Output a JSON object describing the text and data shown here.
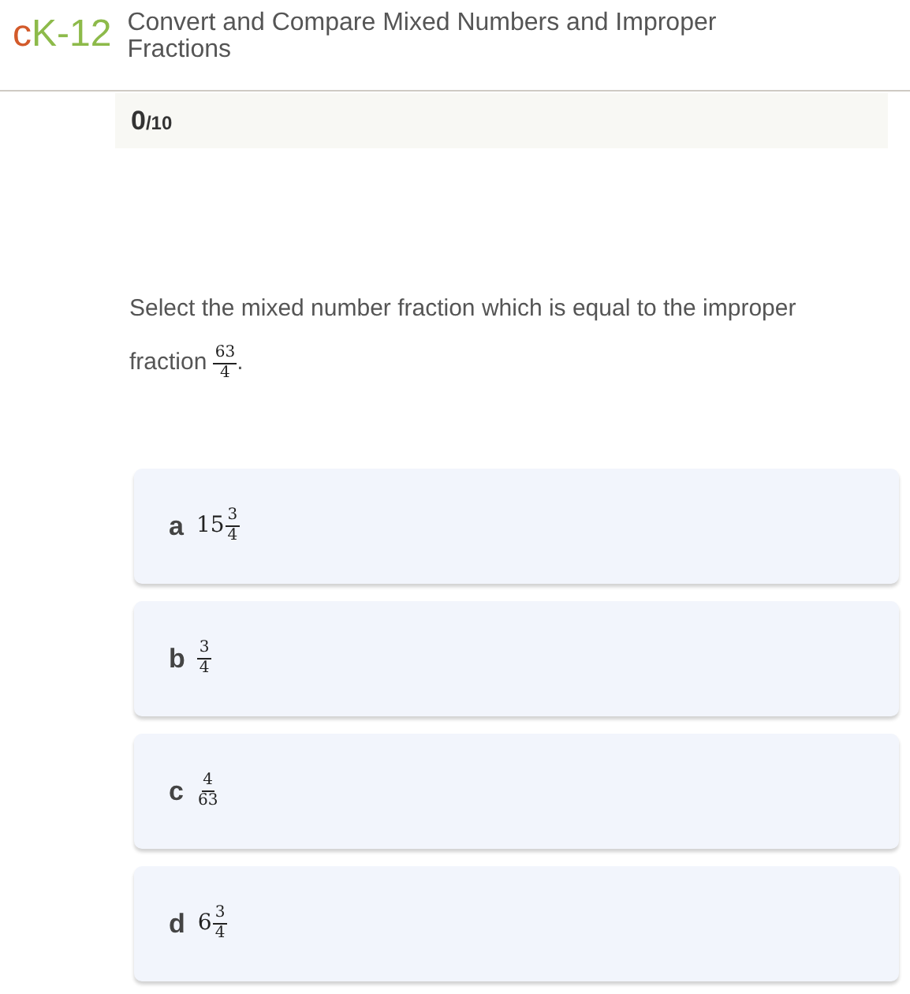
{
  "header": {
    "logo": [
      {
        "text": "c",
        "color": "#d35a2a"
      },
      {
        "text": "K",
        "color": "#8dba4a"
      },
      {
        "text": "-12",
        "color": "#8dba4a"
      }
    ],
    "title": "Convert and Compare Mixed Numbers and Improper Fractions"
  },
  "score": {
    "value": "0",
    "total": "/10"
  },
  "question": {
    "text": "Select the mixed number fraction which is equal to the improper fraction",
    "fraction": {
      "numerator": "63",
      "denominator": "4"
    },
    "end": "."
  },
  "options": [
    {
      "letter": "a",
      "whole": "15",
      "numerator": "3",
      "denominator": "4"
    },
    {
      "letter": "b",
      "numerator": "3",
      "denominator": "4"
    },
    {
      "letter": "c",
      "numerator": "4",
      "denominator": "63"
    },
    {
      "letter": "d",
      "whole": "6",
      "numerator": "3",
      "denominator": "4"
    }
  ]
}
